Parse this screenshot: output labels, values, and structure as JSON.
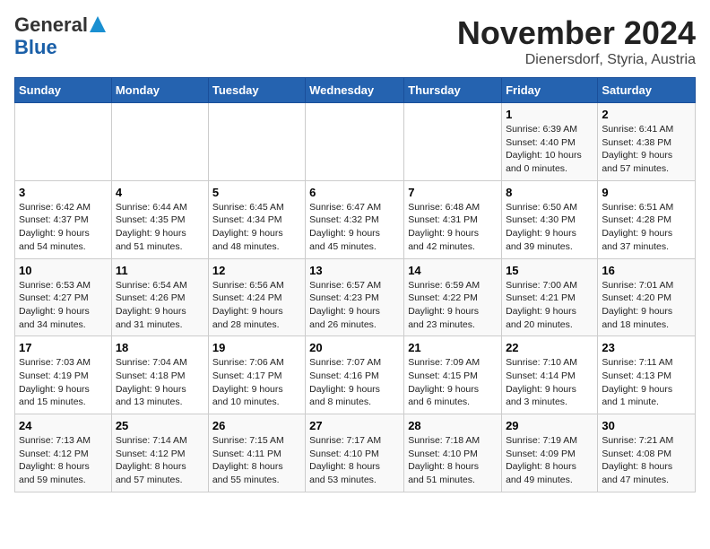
{
  "logo": {
    "line1": "General",
    "line2": "Blue"
  },
  "header": {
    "month": "November 2024",
    "location": "Dienersdorf, Styria, Austria"
  },
  "columns": [
    "Sunday",
    "Monday",
    "Tuesday",
    "Wednesday",
    "Thursday",
    "Friday",
    "Saturday"
  ],
  "weeks": [
    [
      {
        "day": "",
        "info": ""
      },
      {
        "day": "",
        "info": ""
      },
      {
        "day": "",
        "info": ""
      },
      {
        "day": "",
        "info": ""
      },
      {
        "day": "",
        "info": ""
      },
      {
        "day": "1",
        "info": "Sunrise: 6:39 AM\nSunset: 4:40 PM\nDaylight: 10 hours\nand 0 minutes."
      },
      {
        "day": "2",
        "info": "Sunrise: 6:41 AM\nSunset: 4:38 PM\nDaylight: 9 hours\nand 57 minutes."
      }
    ],
    [
      {
        "day": "3",
        "info": "Sunrise: 6:42 AM\nSunset: 4:37 PM\nDaylight: 9 hours\nand 54 minutes."
      },
      {
        "day": "4",
        "info": "Sunrise: 6:44 AM\nSunset: 4:35 PM\nDaylight: 9 hours\nand 51 minutes."
      },
      {
        "day": "5",
        "info": "Sunrise: 6:45 AM\nSunset: 4:34 PM\nDaylight: 9 hours\nand 48 minutes."
      },
      {
        "day": "6",
        "info": "Sunrise: 6:47 AM\nSunset: 4:32 PM\nDaylight: 9 hours\nand 45 minutes."
      },
      {
        "day": "7",
        "info": "Sunrise: 6:48 AM\nSunset: 4:31 PM\nDaylight: 9 hours\nand 42 minutes."
      },
      {
        "day": "8",
        "info": "Sunrise: 6:50 AM\nSunset: 4:30 PM\nDaylight: 9 hours\nand 39 minutes."
      },
      {
        "day": "9",
        "info": "Sunrise: 6:51 AM\nSunset: 4:28 PM\nDaylight: 9 hours\nand 37 minutes."
      }
    ],
    [
      {
        "day": "10",
        "info": "Sunrise: 6:53 AM\nSunset: 4:27 PM\nDaylight: 9 hours\nand 34 minutes."
      },
      {
        "day": "11",
        "info": "Sunrise: 6:54 AM\nSunset: 4:26 PM\nDaylight: 9 hours\nand 31 minutes."
      },
      {
        "day": "12",
        "info": "Sunrise: 6:56 AM\nSunset: 4:24 PM\nDaylight: 9 hours\nand 28 minutes."
      },
      {
        "day": "13",
        "info": "Sunrise: 6:57 AM\nSunset: 4:23 PM\nDaylight: 9 hours\nand 26 minutes."
      },
      {
        "day": "14",
        "info": "Sunrise: 6:59 AM\nSunset: 4:22 PM\nDaylight: 9 hours\nand 23 minutes."
      },
      {
        "day": "15",
        "info": "Sunrise: 7:00 AM\nSunset: 4:21 PM\nDaylight: 9 hours\nand 20 minutes."
      },
      {
        "day": "16",
        "info": "Sunrise: 7:01 AM\nSunset: 4:20 PM\nDaylight: 9 hours\nand 18 minutes."
      }
    ],
    [
      {
        "day": "17",
        "info": "Sunrise: 7:03 AM\nSunset: 4:19 PM\nDaylight: 9 hours\nand 15 minutes."
      },
      {
        "day": "18",
        "info": "Sunrise: 7:04 AM\nSunset: 4:18 PM\nDaylight: 9 hours\nand 13 minutes."
      },
      {
        "day": "19",
        "info": "Sunrise: 7:06 AM\nSunset: 4:17 PM\nDaylight: 9 hours\nand 10 minutes."
      },
      {
        "day": "20",
        "info": "Sunrise: 7:07 AM\nSunset: 4:16 PM\nDaylight: 9 hours\nand 8 minutes."
      },
      {
        "day": "21",
        "info": "Sunrise: 7:09 AM\nSunset: 4:15 PM\nDaylight: 9 hours\nand 6 minutes."
      },
      {
        "day": "22",
        "info": "Sunrise: 7:10 AM\nSunset: 4:14 PM\nDaylight: 9 hours\nand 3 minutes."
      },
      {
        "day": "23",
        "info": "Sunrise: 7:11 AM\nSunset: 4:13 PM\nDaylight: 9 hours\nand 1 minute."
      }
    ],
    [
      {
        "day": "24",
        "info": "Sunrise: 7:13 AM\nSunset: 4:12 PM\nDaylight: 8 hours\nand 59 minutes."
      },
      {
        "day": "25",
        "info": "Sunrise: 7:14 AM\nSunset: 4:12 PM\nDaylight: 8 hours\nand 57 minutes."
      },
      {
        "day": "26",
        "info": "Sunrise: 7:15 AM\nSunset: 4:11 PM\nDaylight: 8 hours\nand 55 minutes."
      },
      {
        "day": "27",
        "info": "Sunrise: 7:17 AM\nSunset: 4:10 PM\nDaylight: 8 hours\nand 53 minutes."
      },
      {
        "day": "28",
        "info": "Sunrise: 7:18 AM\nSunset: 4:10 PM\nDaylight: 8 hours\nand 51 minutes."
      },
      {
        "day": "29",
        "info": "Sunrise: 7:19 AM\nSunset: 4:09 PM\nDaylight: 8 hours\nand 49 minutes."
      },
      {
        "day": "30",
        "info": "Sunrise: 7:21 AM\nSunset: 4:08 PM\nDaylight: 8 hours\nand 47 minutes."
      }
    ]
  ]
}
